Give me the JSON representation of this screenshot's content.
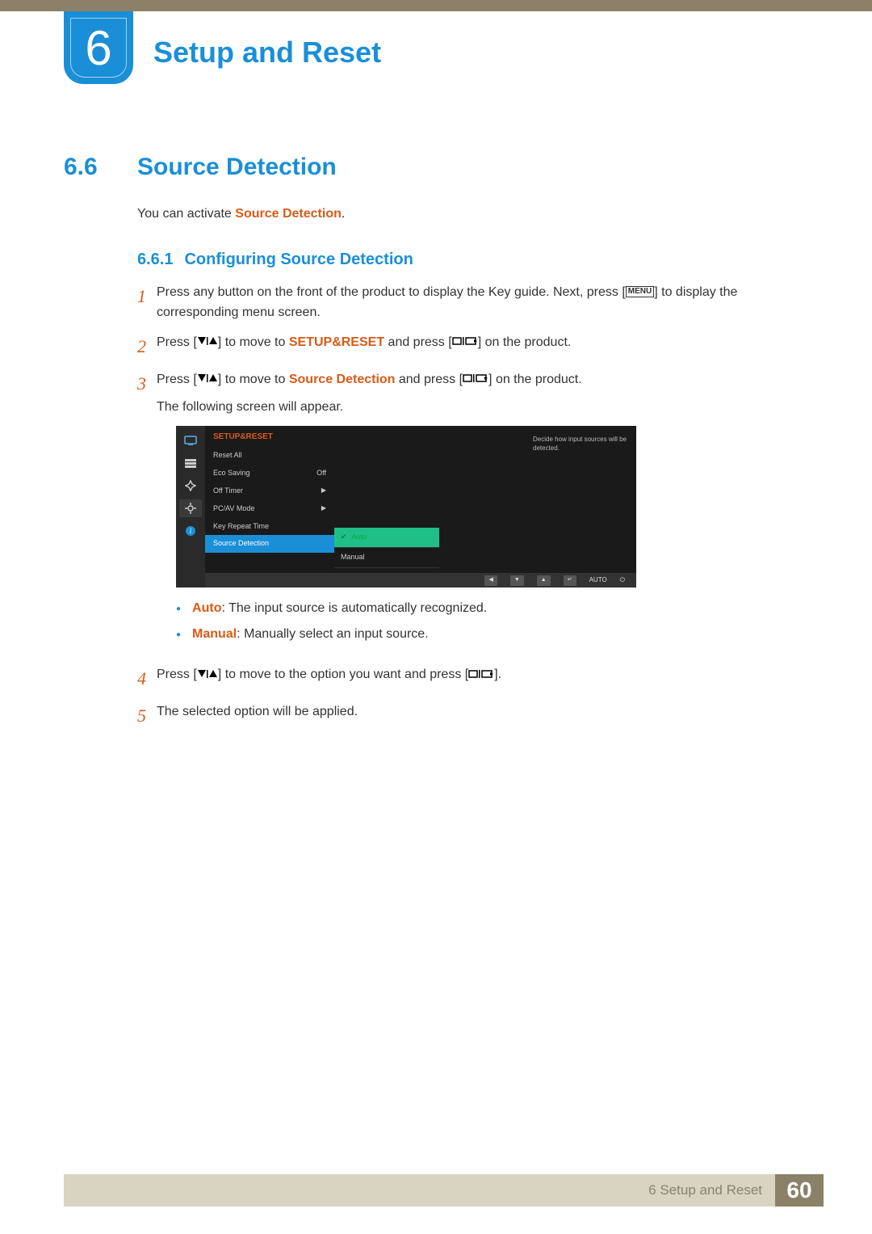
{
  "chapter": {
    "number": "6",
    "title": "Setup and Reset"
  },
  "section": {
    "number": "6.6",
    "title": "Source Detection"
  },
  "intro": {
    "prefix": "You can activate ",
    "hl": "Source Detection",
    "suffix": "."
  },
  "subsection": {
    "number": "6.6.1",
    "title": "Configuring Source Detection"
  },
  "steps": {
    "s1": {
      "num": "1",
      "a": "Press any button on the front of the product to display the Key guide. Next, press [",
      "menu": "MENU",
      "b": "] to display the corresponding menu screen."
    },
    "s2": {
      "num": "2",
      "a": "Press [",
      "b": "] to move to ",
      "hl": "SETUP&RESET",
      "c": " and press [",
      "d": "] on the product."
    },
    "s3": {
      "num": "3",
      "a": "Press [",
      "b": "] to move to ",
      "hl": "Source Detection",
      "c": " and press [",
      "d": "] on the product.",
      "note": "The following screen will appear."
    },
    "s4": {
      "num": "4",
      "a": "Press [",
      "b": "] to move to the option you want and press [",
      "c": "]."
    },
    "s5": {
      "num": "5",
      "a": "The selected option will be applied."
    }
  },
  "bullets": {
    "auto": {
      "hl": "Auto",
      "text": ": The input source is automatically recognized."
    },
    "manual": {
      "hl": "Manual",
      "text": ": Manually select an input source."
    }
  },
  "osd": {
    "header": "SETUP&RESET",
    "items": {
      "reset": "Reset All",
      "eco": "Eco Saving",
      "eco_val": "Off",
      "off_timer": "Off Timer",
      "pcav": "PC/AV Mode",
      "key_repeat": "Key Repeat Time",
      "source": "Source Detection"
    },
    "options": {
      "auto": "Auto",
      "manual": "Manual"
    },
    "desc": "Decide how input sources will be detected.",
    "footer_auto": "AUTO"
  },
  "footer": {
    "label": "6 Setup and Reset",
    "page": "60"
  }
}
